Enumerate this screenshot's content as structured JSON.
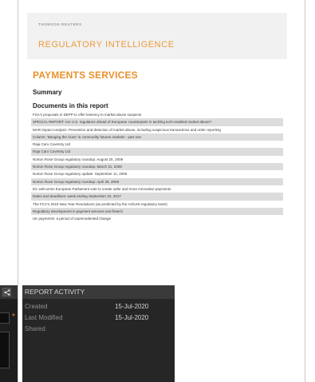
{
  "document": {
    "publisher": "THOMSON REUTERS",
    "product": "REGULATORY INTELLIGENCE",
    "section_title": "PAYMENTS SERVICES",
    "summary_heading": "Summary",
    "documents_heading": "Documents in this report",
    "documents": [
      "FSA's proposals in DEPP to offer leniency to market abuse suspects",
      "SPECIAL REPORT: Are U.S. regulators ahead of European counterparts in tackling tech-enabled market abuse?",
      "MAR Impact Analysis: Prevention and detection of market abuse, including suspicious transactions and order reporting",
      "Column: 'Banging the close' in commodity futures markets - part one",
      "Raja Caro Coventry Ltd",
      "Raja Caro Coventry Ltd",
      "Norton Rose Group regulatory roundup: August 25, 2009",
      "Norton Rose Group regulatory roundup: March 31, 2009",
      "Norton Rose Group regulatory update: September 11, 2009",
      "Norton Rose Group regulatory roundup: April 28, 2009",
      "EC welcomes European Parliament vote to create safer and more innovative payments",
      "Dates and deadlines: week ending September 22, 2017",
      "The FCA's 2019 New Year Resolutions (as predicted by the Ashurst regulatory team)",
      "Regulatory development in payment services and fintech",
      "UK payments: a period of unprecedented change"
    ]
  },
  "left_panel": {
    "share_icon": "share-icon",
    "required_marker": "*"
  },
  "report_activity": {
    "title": "REPORT ACTIVITY",
    "rows": [
      {
        "label": "Created",
        "value": "15-Jul-2020"
      },
      {
        "label": "Last Modified",
        "value": "15-Jul-2020"
      },
      {
        "label": "Shared",
        "value": ""
      }
    ]
  },
  "colors": {
    "accent_orange": "#e8922d",
    "panel_dark": "#262626",
    "panel_header": "#3a3a3a"
  }
}
